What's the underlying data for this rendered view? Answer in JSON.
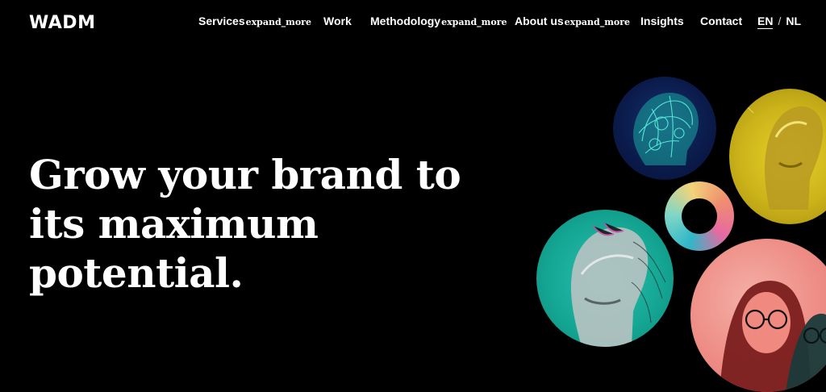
{
  "brand": {
    "logo": "WADM"
  },
  "nav": {
    "services": "Services",
    "services_icon": "expand_more",
    "work": "Work",
    "methodology": "Methodology",
    "methodology_icon": "expand_more",
    "about": "About us",
    "about_icon": "expand_more",
    "insights": "Insights",
    "contact": "Contact"
  },
  "lang": {
    "en": "EN",
    "sep": "/",
    "nl": "NL"
  },
  "hero": {
    "line1": "Grow your brand to",
    "line2": "its maximum",
    "line3": "potential."
  },
  "colors": {
    "background": "#000000",
    "text": "#ffffff",
    "teal": "#1bb7a6",
    "yellow": "#d4bd1e",
    "navy": "#0c1f5a",
    "pink": "#ee8080"
  }
}
